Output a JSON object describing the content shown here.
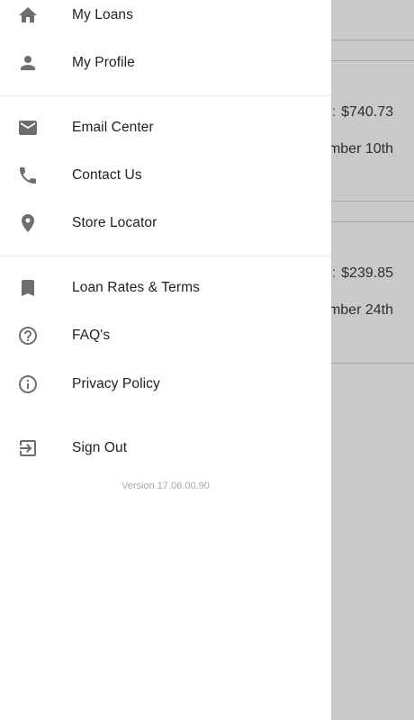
{
  "drawer": {
    "items": [
      {
        "label": "My Loans",
        "icon": "home-icon"
      },
      {
        "label": "My Profile",
        "icon": "person-icon"
      },
      {
        "label": "Email Center",
        "icon": "mail-icon"
      },
      {
        "label": "Contact Us",
        "icon": "phone-icon"
      },
      {
        "label": "Store Locator",
        "icon": "location-pin-icon"
      },
      {
        "label": "Loan Rates & Terms",
        "icon": "bookmark-icon"
      },
      {
        "label": "FAQ's",
        "icon": "help-circle-icon"
      },
      {
        "label": "Privacy Policy",
        "icon": "info-circle-icon"
      },
      {
        "label": "Sign Out",
        "icon": "sign-out-icon"
      }
    ],
    "version": "Version 17.06.00.90"
  },
  "background": {
    "loans": [
      {
        "amount": "$740.73",
        "date_fragment": "mber 10th"
      },
      {
        "amount": "$239.85",
        "date_fragment": "mber 24th"
      }
    ]
  },
  "colors": {
    "drawer_bg": "#ffffff",
    "icon": "#6e6e6e",
    "overlay": "#c9c9c9",
    "text": "#1f1f1f"
  }
}
